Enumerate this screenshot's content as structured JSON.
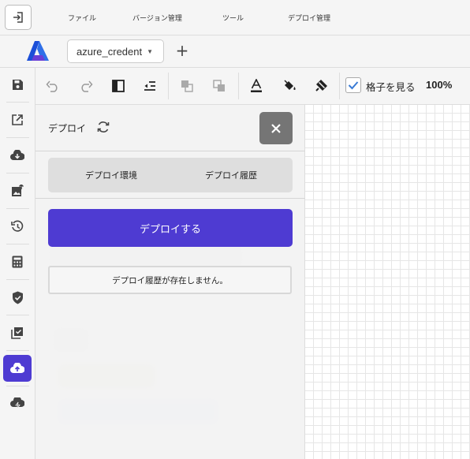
{
  "menubar": {
    "items": [
      {
        "label": "ファイル"
      },
      {
        "label": "バージョン管理"
      },
      {
        "label": "ツール"
      },
      {
        "label": "デプロイ管理"
      }
    ]
  },
  "document": {
    "selected": "azure_credent"
  },
  "toolbar": {
    "grid_label": "格子を見る",
    "grid_checked": true,
    "zoom": "100%"
  },
  "deploy_panel": {
    "title": "デプロイ",
    "tabs": [
      {
        "label": "デプロイ環境"
      },
      {
        "label": "デプロイ履歴"
      }
    ],
    "deploy_button": "デプロイする",
    "empty_message": "デプロイ履歴が存在しません。"
  },
  "colors": {
    "accent": "#4e3bd2",
    "close_button": "#757575"
  }
}
